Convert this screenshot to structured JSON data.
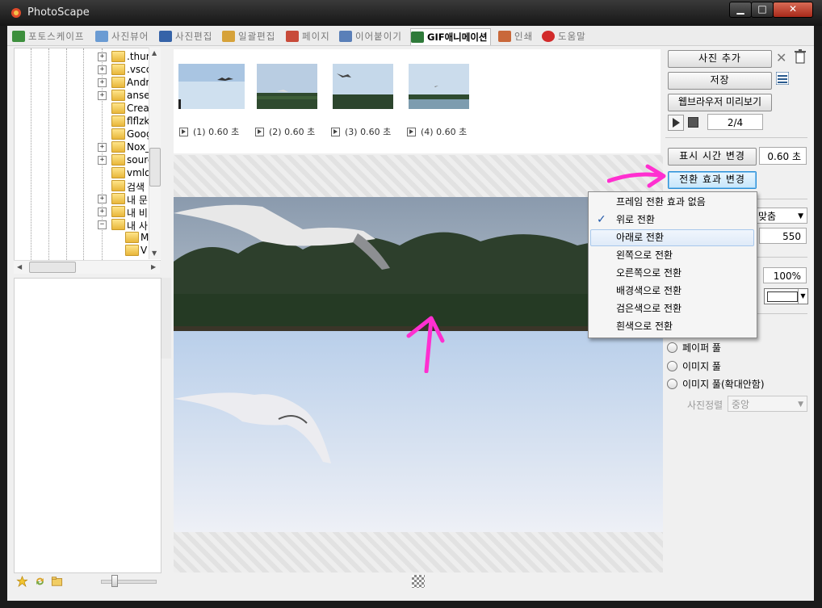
{
  "window": {
    "title": "PhotoScape"
  },
  "tabs": [
    {
      "label": "포토스케이프",
      "color": "#3d8f3d"
    },
    {
      "label": "사진뷰어",
      "color": "#6a9bd3"
    },
    {
      "label": "사진편집",
      "color": "#3563a8"
    },
    {
      "label": "일괄편집",
      "color": "#d6a23a"
    },
    {
      "label": "페이지",
      "color": "#c84b3a"
    },
    {
      "label": "이어붙이기",
      "color": "#5a7fb8"
    },
    {
      "label": "GIF애니메이션",
      "color": "#2f7a3a"
    },
    {
      "label": "인쇄",
      "color": "#c9683a"
    },
    {
      "label": "도움말",
      "color": "#d22b2b"
    }
  ],
  "tree": {
    "items": [
      {
        "label": ".thur",
        "expandable": true
      },
      {
        "label": ".vscc",
        "expandable": true
      },
      {
        "label": "Andr",
        "expandable": true
      },
      {
        "label": "anse",
        "expandable": true
      },
      {
        "label": "Creat",
        "expandable": false
      },
      {
        "label": "flflzk2",
        "expandable": false
      },
      {
        "label": "Goog",
        "expandable": false
      },
      {
        "label": "Nox_",
        "expandable": true
      },
      {
        "label": "sourc",
        "expandable": true
      },
      {
        "label": "vmlo",
        "expandable": false
      },
      {
        "label": "검색",
        "expandable": false
      },
      {
        "label": "내 문",
        "expandable": true
      },
      {
        "label": "내 비",
        "expandable": true
      },
      {
        "label": "내 사",
        "expandable": true
      },
      {
        "label": "M",
        "expandable": false
      },
      {
        "label": "V",
        "expandable": false
      }
    ]
  },
  "frames": [
    {
      "label": "(1) 0.60 초"
    },
    {
      "label": "(2) 0.60 초"
    },
    {
      "label": "(3) 0.60 초"
    },
    {
      "label": "(4) 0.60 초"
    }
  ],
  "right_panel": {
    "add_photo": "사진 추가",
    "save": "저장",
    "browser_preview": "웹브라우저 미리보기",
    "frame_counter": "2/4",
    "change_display_time": "표시 시간 변경",
    "display_time": "0.60 초",
    "change_transition": "전환 효과 변경",
    "size_select": "맞춤",
    "height_value": "550",
    "zoom_value": "100%",
    "radio_paper": "페이퍼 풀",
    "radio_image": "이미지 풀",
    "radio_image_noenlarge": "이미지 풀(확대안함)",
    "align_label": "사진정렬",
    "align_value": "중앙"
  },
  "context_menu": {
    "items": [
      {
        "label": "프레임 전환 효과 없음",
        "checked": false,
        "hover": false
      },
      {
        "label": "위로 전환",
        "checked": true,
        "hover": false
      },
      {
        "label": "아래로 전환",
        "checked": false,
        "hover": true
      },
      {
        "label": "왼쪽으로 전환",
        "checked": false,
        "hover": false
      },
      {
        "label": "오른쪽으로 전환",
        "checked": false,
        "hover": false
      },
      {
        "label": "배경색으로 전환",
        "checked": false,
        "hover": false
      },
      {
        "label": "검은색으로 전환",
        "checked": false,
        "hover": false
      },
      {
        "label": "흰색으로 전환",
        "checked": false,
        "hover": false
      }
    ]
  },
  "icons": {
    "check": "✓",
    "annotation_color": "#ff2fd0"
  }
}
